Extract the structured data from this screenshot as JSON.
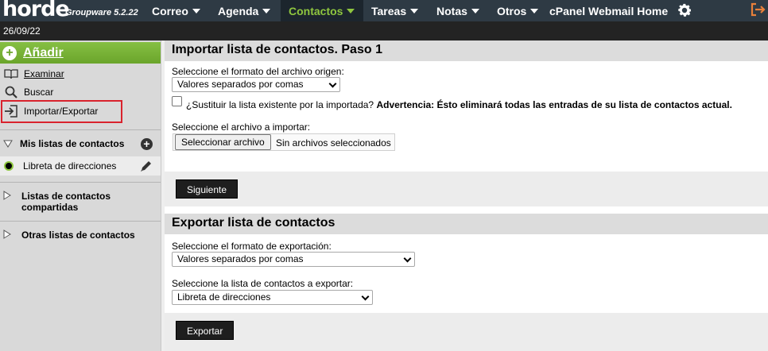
{
  "header": {
    "logo": "horde",
    "version": "Groupware 5.2.22",
    "nav": [
      {
        "label": "Correo",
        "has_menu": true,
        "active": false
      },
      {
        "label": "Agenda",
        "has_menu": true,
        "active": false
      },
      {
        "label": "Contactos",
        "has_menu": true,
        "active": true
      },
      {
        "label": "Tareas",
        "has_menu": true,
        "active": false
      },
      {
        "label": "Notas",
        "has_menu": true,
        "active": false
      },
      {
        "label": "Otros",
        "has_menu": true,
        "active": false
      },
      {
        "label": "cPanel Webmail Home",
        "has_menu": false,
        "active": false
      }
    ],
    "settings_icon": "gear-icon",
    "logout_icon": "logout-icon",
    "date": "26/09/22"
  },
  "sidebar": {
    "add_label": "Añadir",
    "links": [
      {
        "label": "Examinar",
        "icon": "book-icon"
      },
      {
        "label": "Buscar",
        "icon": "search-icon"
      },
      {
        "label": "Importar/Exportar",
        "icon": "import-export-icon"
      }
    ],
    "my_lists": {
      "title": "Mis listas de contactos",
      "items": [
        {
          "label": "Libreta de direcciones"
        }
      ]
    },
    "shared_lists": {
      "title": "Listas de contactos compartidas"
    },
    "other_lists": {
      "title": "Otras listas de contactos"
    }
  },
  "import": {
    "title": "Importar lista de contactos. Paso 1",
    "format_label": "Seleccione el formato del archivo origen:",
    "format_value": "Valores separados por comas",
    "replace_question": "¿Sustituir la lista existente por la importada?",
    "replace_warning": "Advertencia: Ésto eliminará todas las entradas de su lista de contactos actual.",
    "file_label": "Seleccione el archivo a importar:",
    "file_button": "Seleccionar archivo",
    "file_status": "Sin archivos seleccionados",
    "next_button": "Siguiente"
  },
  "export": {
    "title": "Exportar lista de contactos",
    "format_label": "Seleccione el formato de exportación:",
    "format_value": "Valores separados por comas",
    "list_label": "Seleccione la lista de contactos a exportar:",
    "list_value": "Libreta de direcciones",
    "export_button": "Exportar"
  },
  "colors": {
    "topbar": "#2e3a44",
    "active_nav": "#8fc63f",
    "add_button": "#7ab539",
    "highlight": "#d9232d"
  }
}
